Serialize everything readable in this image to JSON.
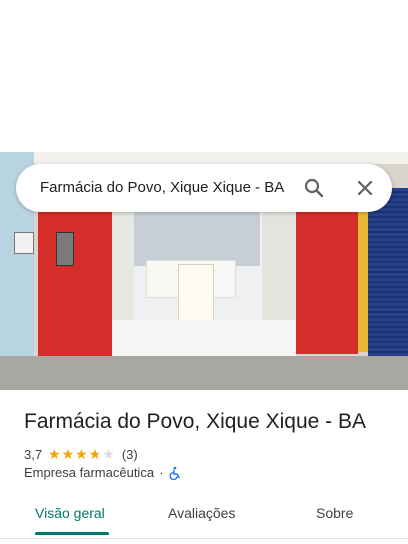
{
  "search": {
    "query": "Farmácia do Povo, Xique Xique - BA"
  },
  "place": {
    "title": "Farmácia do Povo, Xique Xique - BA",
    "rating_text": "3,7",
    "rating_value": 3.7,
    "rating_max": 5,
    "review_count": "(3)",
    "category": "Empresa farmacêutica",
    "separator": "·",
    "accessibility_icon": "wheelchair-icon"
  },
  "tabs": [
    {
      "label": "Visão geral",
      "active": true
    },
    {
      "label": "Avaliações",
      "active": false
    },
    {
      "label": "Sobre",
      "active": false
    }
  ],
  "colors": {
    "accent": "#00796b",
    "star": "#f2a600",
    "accessibility": "#1a73e8"
  }
}
